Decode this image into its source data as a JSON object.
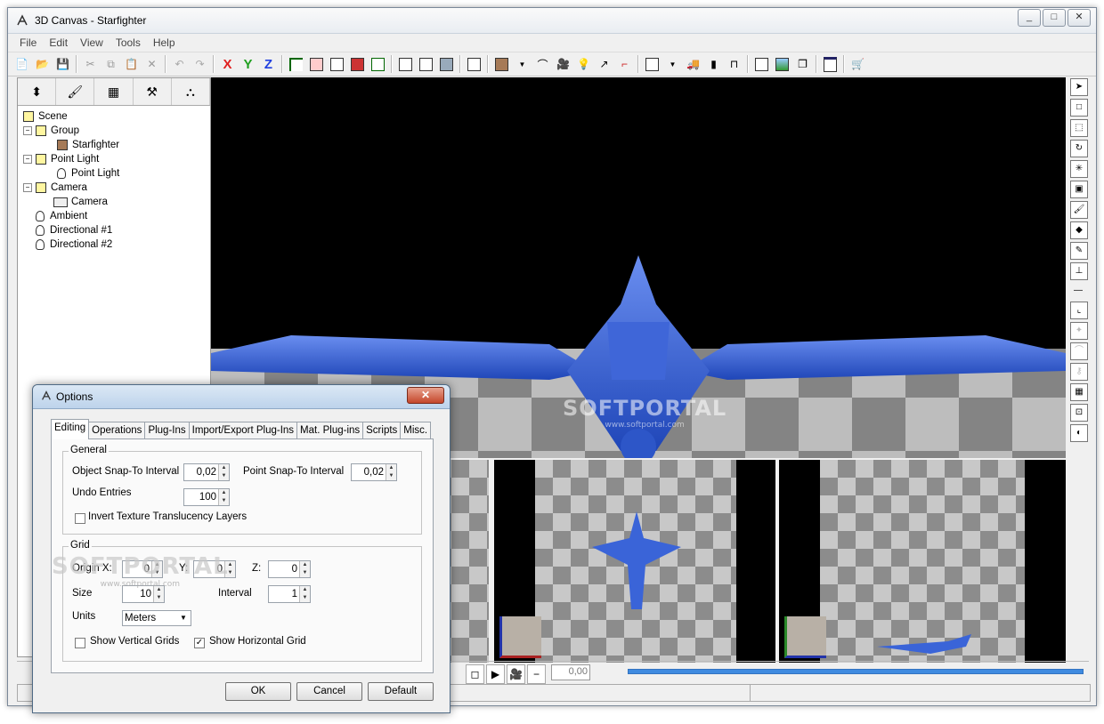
{
  "window": {
    "title": "3D Canvas - Starfighter"
  },
  "menu": [
    "File",
    "Edit",
    "View",
    "Tools",
    "Help"
  ],
  "toolbar": {
    "x_label": "X",
    "y_label": "Y",
    "z_label": "Z"
  },
  "tree": [
    {
      "label": "Scene",
      "icon": "cube-icon",
      "depth": 0
    },
    {
      "label": "Group",
      "icon": "cube-icon",
      "depth": 1
    },
    {
      "label": "Starfighter",
      "icon": "mesh-icon",
      "depth": 2
    },
    {
      "label": "Point Light",
      "icon": "cube-icon",
      "depth": 1
    },
    {
      "label": "Point Light",
      "icon": "bulb-icon",
      "depth": 2
    },
    {
      "label": "Camera",
      "icon": "cube-icon",
      "depth": 1
    },
    {
      "label": "Camera",
      "icon": "camera-icon",
      "depth": 2
    },
    {
      "label": "Ambient",
      "icon": "bulb-icon",
      "depth": 1
    },
    {
      "label": "Directional #1",
      "icon": "bulb-icon",
      "depth": 1
    },
    {
      "label": "Directional #2",
      "icon": "bulb-icon",
      "depth": 1
    }
  ],
  "timeline": {
    "value": "0,00"
  },
  "watermark": {
    "brand": "SOFTPORTAL",
    "url": "www.softportal.com"
  },
  "dialog": {
    "title": "Options",
    "tabs": [
      "Editing",
      "Operations",
      "Plug-Ins",
      "Import/Export Plug-Ins",
      "Mat. Plug-ins",
      "Scripts",
      "Misc."
    ],
    "general": {
      "label": "General",
      "object_snap_label": "Object Snap-To Interval",
      "object_snap_value": "0,02",
      "point_snap_label": "Point Snap-To Interval",
      "point_snap_value": "0,02",
      "undo_label": "Undo Entries",
      "undo_value": "100",
      "invert_label": "Invert Texture Translucency Layers",
      "invert_checked": false
    },
    "grid": {
      "label": "Grid",
      "origin_label": "Origin X:",
      "origin_x": "0",
      "y_label": "Y:",
      "origin_y": "0",
      "z_label": "Z:",
      "origin_z": "0",
      "size_label": "Size",
      "size_value": "10",
      "interval_label": "Interval",
      "interval_value": "1",
      "units_label": "Units",
      "units_value": "Meters",
      "vertical_label": "Show Vertical Grids",
      "vertical_checked": false,
      "horizontal_label": "Show Horizontal Grid",
      "horizontal_checked": true
    },
    "buttons": {
      "ok": "OK",
      "cancel": "Cancel",
      "default": "Default"
    }
  },
  "colors": {
    "ship": "#2f5fd0",
    "ship_light": "#6a8ef0",
    "floor_dark": "#8c8c8c",
    "floor_light": "#c8c8c8"
  }
}
